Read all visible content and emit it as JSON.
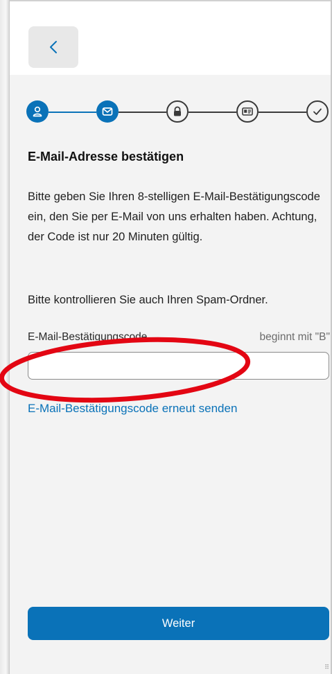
{
  "header": {
    "back_icon": "chevron-left-icon"
  },
  "stepper": {
    "steps": [
      {
        "icon": "user-icon",
        "state": "active"
      },
      {
        "icon": "envelope-icon",
        "state": "active"
      },
      {
        "icon": "lock-icon",
        "state": "inactive"
      },
      {
        "icon": "id-card-icon",
        "state": "inactive"
      },
      {
        "icon": "check-icon",
        "state": "inactive"
      }
    ],
    "active_color": "#0a72b8",
    "inactive_color": "#3a3a3a"
  },
  "main": {
    "title": "E-Mail-Adresse bestätigen",
    "description": "Bitte geben Sie Ihren 8-stelligen E-Mail-Bestätigungscode ein, den Sie per E-Mail von uns erhalten haben. Achtung, der Code ist nur 20 Minuten gültig.",
    "spam_note": "Bitte kontrollieren Sie auch Ihren Spam-Ordner.",
    "code_field": {
      "label": "E-Mail-Bestätigungscode",
      "hint": "beginnt mit \"B\"",
      "value": "",
      "placeholder": ""
    },
    "resend_link": "E-Mail-Bestätigungscode erneut senden",
    "submit_button": "Weiter"
  },
  "annotation": {
    "color": "#e30613"
  },
  "colors": {
    "accent": "#0a72b8",
    "background": "#f3f3f3"
  }
}
